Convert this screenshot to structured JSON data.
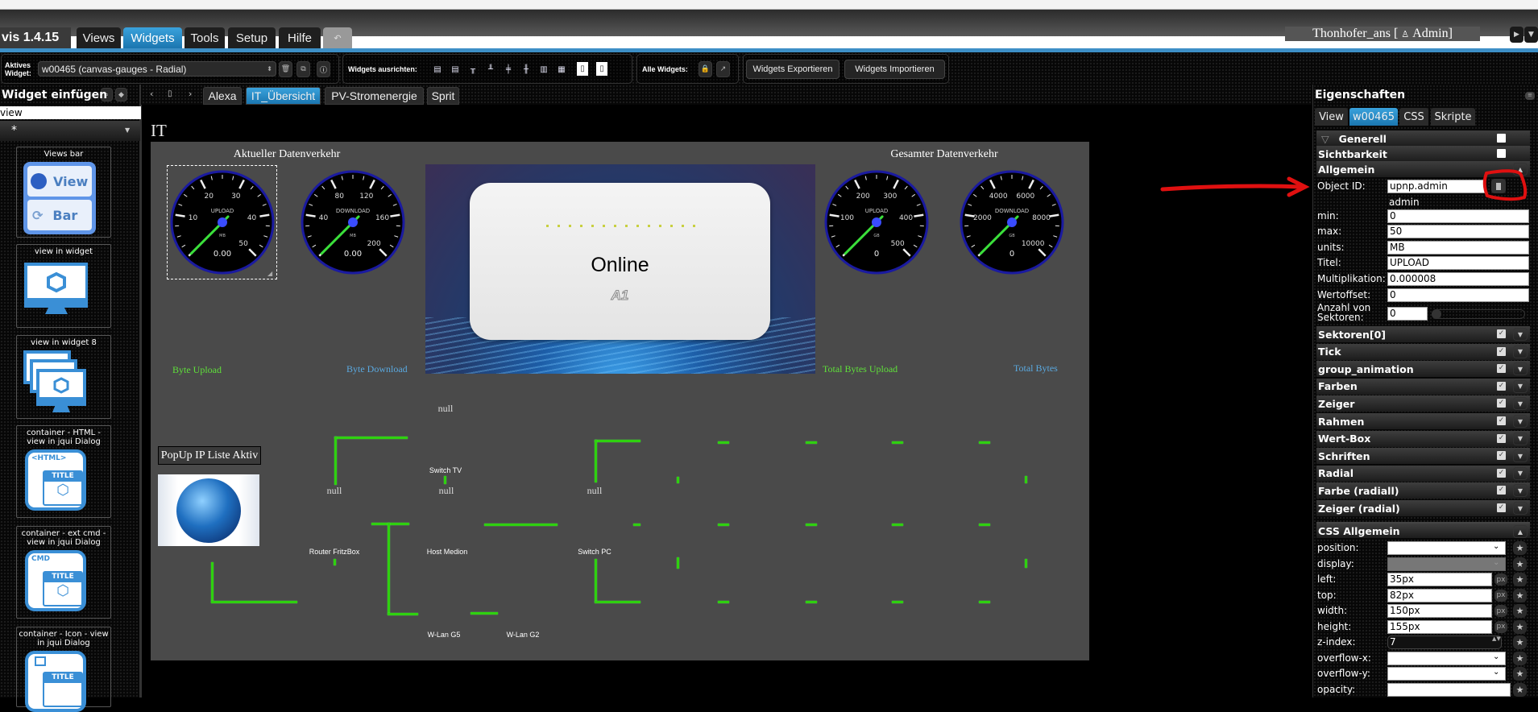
{
  "app": {
    "version": "vis 1.4.15",
    "user": "Thonhofer_ans [",
    "role": "Admin]"
  },
  "menu": {
    "tabs": [
      "Views",
      "Widgets",
      "Tools",
      "Setup",
      "Hilfe"
    ],
    "active": "Widgets"
  },
  "toolbar": {
    "active_widget_label": "Aktives Widget:",
    "active_widget_value": "w00465 (canvas-gauges - Radial)",
    "align_label": "Widgets ausrichten:",
    "all_widgets_label": "Alle Widgets:",
    "export_label": "Widgets Exportieren",
    "import_label": "Widgets Importieren"
  },
  "left_panel": {
    "title": "Widget einfügen",
    "filter_value": "view",
    "set_value": "*",
    "widgets": [
      {
        "label": "Views bar",
        "icon": "views-bar",
        "img_text1": "View",
        "img_text2": "Bar"
      },
      {
        "label": "view in widget",
        "icon": "monitor"
      },
      {
        "label": "view in widget 8",
        "icon": "monitor-stack"
      },
      {
        "label": "container - HTML - view in jqui Dialog",
        "icon": "dialog-html",
        "img_tag": "<HTML>",
        "img_title": "TITLE"
      },
      {
        "label": "container - ext cmd - view in jqui Dialog",
        "icon": "dialog-cmd",
        "img_tag": "CMD",
        "img_title": "TITLE"
      },
      {
        "label": "container - Icon - view in jqui Dialog",
        "icon": "dialog-icon",
        "img_title": "TITLE"
      }
    ]
  },
  "view_tabs": {
    "items": [
      "Alexa",
      "IT_Übersicht",
      "PV-Stromenergie",
      "Sprit"
    ],
    "active": "IT_Übersicht"
  },
  "canvas": {
    "view_title": "IT",
    "current_traffic_title": "Aktueller Datenverkehr",
    "total_traffic_title": "Gesamter Datenverkehr",
    "byte_upload": "Byte Upload",
    "byte_download": "Byte Download",
    "total_upload": "Total Bytes Upload",
    "total_bytes": "Total Bytes",
    "router_status": "Online",
    "router_brand": "A1",
    "popup_button": "PopUp IP Liste Aktiv",
    "network": {
      "null_label": "null",
      "switch_tv": "Switch TV",
      "router_fritzbox": "Router FritzBox",
      "host_medion": "Host Medion",
      "switch_pc": "Switch PC",
      "wlan_g5": "W-Lan G5",
      "wlan_g2": "W-Lan G2"
    }
  },
  "gauges": [
    {
      "title": "UPLOAD",
      "units": "MB",
      "min": 0,
      "max": 50,
      "ticks": [
        0,
        10,
        20,
        30,
        40,
        50
      ],
      "value": 0,
      "display": "0.00"
    },
    {
      "title": "DOWNLOAD",
      "units": "MB",
      "min": 0,
      "max": 200,
      "ticks": [
        0,
        40,
        80,
        120,
        160,
        200
      ],
      "value": 0,
      "display": "0.00"
    },
    {
      "title": "UPLOAD",
      "units": "GB",
      "min": 0,
      "max": 500,
      "ticks": [
        0,
        100,
        200,
        300,
        400,
        500
      ],
      "value": 0,
      "display": "0"
    },
    {
      "title": "DOWNLOAD",
      "units": "GB",
      "min": 0,
      "max": 10000,
      "ticks": [
        0,
        2000,
        4000,
        6000,
        8000,
        10000
      ],
      "value": 0,
      "display": "0"
    }
  ],
  "properties": {
    "title": "Eigenschaften",
    "tabs": [
      "View",
      "w00465",
      "CSS",
      "Skripte"
    ],
    "active_tab": "w00465",
    "generell": "Generell",
    "sichtbarkeit": "Sichtbarkeit",
    "allgemein": "Allgemein",
    "object_id_label": "Object ID:",
    "object_id_value": "upnp.admin",
    "object_id_name": "admin",
    "fields": [
      {
        "label": "min:",
        "value": "0"
      },
      {
        "label": "max:",
        "value": "50"
      },
      {
        "label": "units:",
        "value": "MB"
      },
      {
        "label": "Titel:",
        "value": "UPLOAD"
      },
      {
        "label": "Multiplikation:",
        "value": "0.000008"
      },
      {
        "label": "Wertoffset:",
        "value": "0"
      }
    ],
    "sectors_label_1": "Anzahl von",
    "sectors_label_2": "Sektoren:",
    "sectors_value": "0",
    "groups": [
      "Sektoren[0]",
      "Tick",
      "group_animation",
      "Farben",
      "Zeiger",
      "Rahmen",
      "Wert-Box",
      "Schriften",
      "Radial",
      "Farbe (radiall)",
      "Zeiger (radial)"
    ],
    "css_title": "CSS Allgemein",
    "css_fields": [
      {
        "label": "position:",
        "value": "",
        "type": "select"
      },
      {
        "label": "display:",
        "value": "",
        "type": "disabled"
      },
      {
        "label": "left:",
        "value": "35px",
        "type": "px"
      },
      {
        "label": "top:",
        "value": "82px",
        "type": "px"
      },
      {
        "label": "width:",
        "value": "150px",
        "type": "px"
      },
      {
        "label": "height:",
        "value": "155px",
        "type": "px"
      },
      {
        "label": "z-index:",
        "value": "7",
        "type": "spin"
      },
      {
        "label": "overflow-x:",
        "value": "",
        "type": "select"
      },
      {
        "label": "overflow-y:",
        "value": "",
        "type": "select"
      },
      {
        "label": "opacity:",
        "value": "",
        "type": "text"
      }
    ],
    "px_label": "px"
  },
  "colors": {
    "accent": "#2b8fd0",
    "line_green": "#2fd10f",
    "annotation_red": "#e01010"
  }
}
